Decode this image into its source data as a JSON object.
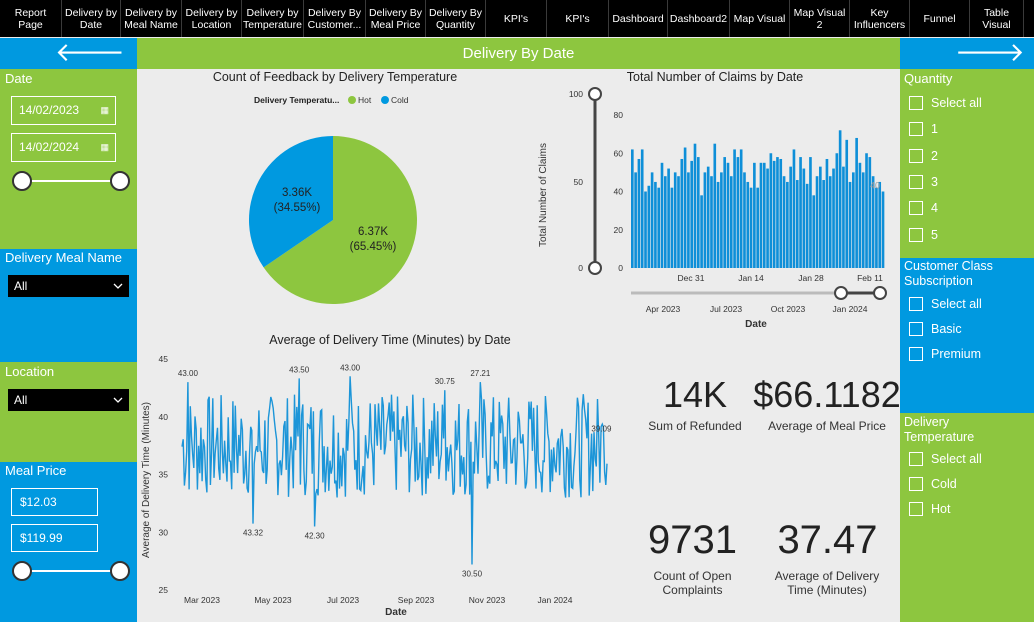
{
  "nav": {
    "tabs": [
      {
        "label": "Report Page",
        "w": 62
      },
      {
        "label": "Delivery by\nDate",
        "w": 59
      },
      {
        "label": "Delivery by\nMeal Name",
        "w": 61
      },
      {
        "label": "Delivery by\nLocation",
        "w": 60
      },
      {
        "label": "Delivery by\nTemperature",
        "w": 62
      },
      {
        "label": "Delivery By\nCustomer...",
        "w": 62
      },
      {
        "label": "Delivery By\nMeal Price",
        "w": 60
      },
      {
        "label": "Delivery By\nQuantity",
        "w": 60
      },
      {
        "label": "KPI's",
        "w": 61
      },
      {
        "label": "KPI's",
        "w": 62
      },
      {
        "label": "Dashboard",
        "w": 59
      },
      {
        "label": "Dashboard2",
        "w": 62
      },
      {
        "label": "Map Visual",
        "w": 60
      },
      {
        "label": "Map Visual\n2",
        "w": 60
      },
      {
        "label": "Key\nInfluencers",
        "w": 60
      },
      {
        "label": "Funnel",
        "w": 60
      },
      {
        "label": "Table Visual",
        "w": 54
      }
    ]
  },
  "header": {
    "title": "Delivery By Date",
    "back_arrow": "🡐",
    "forward_arrow": "🡒"
  },
  "left": {
    "date": {
      "title": "Date",
      "start": "14/02/2023",
      "end": "14/02/2024"
    },
    "meal_name": {
      "title": "Delivery Meal Name",
      "value": "All"
    },
    "location": {
      "title": "Location",
      "value": "All"
    },
    "meal_price": {
      "title": "Meal Price",
      "min": "$12.03",
      "max": "$119.99"
    }
  },
  "right": {
    "quantity": {
      "title": "Quantity",
      "options": [
        "Select all",
        "1",
        "2",
        "3",
        "4",
        "5"
      ]
    },
    "customer": {
      "title": "Customer Class\nSubscription",
      "options": [
        "Select all",
        "Basic",
        "Premium"
      ]
    },
    "temperature": {
      "title": "Delivery\nTemperature",
      "options": [
        "Select all",
        "Cold",
        "Hot"
      ]
    }
  },
  "pie": {
    "title": "Count of Feedback by Delivery Temperature",
    "legend_title": "Delivery Temperatu...",
    "legend_hot": "Hot",
    "legend_cold": "Cold",
    "hot_label": "6.37K",
    "hot_pct": "(65.45%)",
    "cold_label": "3.36K",
    "cold_pct": "(34.55%)"
  },
  "kpis": {
    "refunded_value": "14K",
    "refunded_label": "Sum of Refunded",
    "meal_price_value": "$66.1182",
    "meal_price_label": "Average of Meal Price",
    "complaints_value": "9731",
    "complaints_label": "Count of Open\nComplaints",
    "delivery_value": "37.47",
    "delivery_label": "Average of Delivery\nTime (Minutes)"
  },
  "colors": {
    "green": "#8dc63f",
    "blue": "#0099e0",
    "dark": "#000000"
  },
  "chart_data": [
    {
      "type": "pie",
      "title": "Count of Feedback by Delivery Temperature",
      "legend_title": "Delivery Temperatu...",
      "slices": [
        {
          "name": "Hot",
          "value": 6370,
          "label": "6.37K (65.45%)",
          "color": "#8dc63f"
        },
        {
          "name": "Cold",
          "value": 3360,
          "label": "3.36K (34.55%)",
          "color": "#0099e0"
        }
      ]
    },
    {
      "type": "bar",
      "title": "Total Number of Claims by Date",
      "xlabel": "Date",
      "ylabel": "Total Number of Claims",
      "ylim": [
        0,
        80
      ],
      "yticks": [
        "0",
        "20",
        "40",
        "60",
        "80"
      ],
      "xticks": [
        "Dec 31",
        "Jan 14",
        "Jan 28",
        "Feb 11"
      ],
      "last_label": "40",
      "range_ticks": [
        "Apr 2023",
        "Jul 2023",
        "Oct 2023",
        "Jan 2024"
      ],
      "range_slider_labels": [
        "100",
        "50",
        "0"
      ],
      "values": [
        62,
        50,
        57,
        62,
        40,
        43,
        50,
        45,
        42,
        55,
        48,
        52,
        42,
        50,
        48,
        57,
        63,
        50,
        56,
        65,
        58,
        38,
        50,
        53,
        48,
        65,
        45,
        50,
        58,
        55,
        48,
        62,
        58,
        62,
        50,
        45,
        42,
        55,
        42,
        55,
        55,
        52,
        60,
        56,
        58,
        57,
        48,
        45,
        53,
        62,
        46,
        58,
        52,
        44,
        58,
        38,
        48,
        53,
        46,
        57,
        48,
        52,
        60,
        72,
        53,
        67,
        45,
        50,
        68,
        55,
        50,
        60,
        58,
        48,
        42,
        45,
        40
      ]
    },
    {
      "type": "line",
      "title": "Average of Delivery Time (Minutes) by Date",
      "xlabel": "Date",
      "ylabel": "Average of Delivery Time (Minutes)",
      "ylim": [
        25,
        45
      ],
      "yticks": [
        "25",
        "30",
        "35",
        "40",
        "45"
      ],
      "xticks": [
        "Mar 2023",
        "May 2023",
        "Jul 2023",
        "Sep 2023",
        "Nov 2023",
        "Jan 2024"
      ],
      "annotations": [
        "43.00",
        "43.32",
        "43.50",
        "42.30",
        "43.00",
        "30.75",
        "30.50",
        "27.21",
        "39.09"
      ]
    }
  ]
}
